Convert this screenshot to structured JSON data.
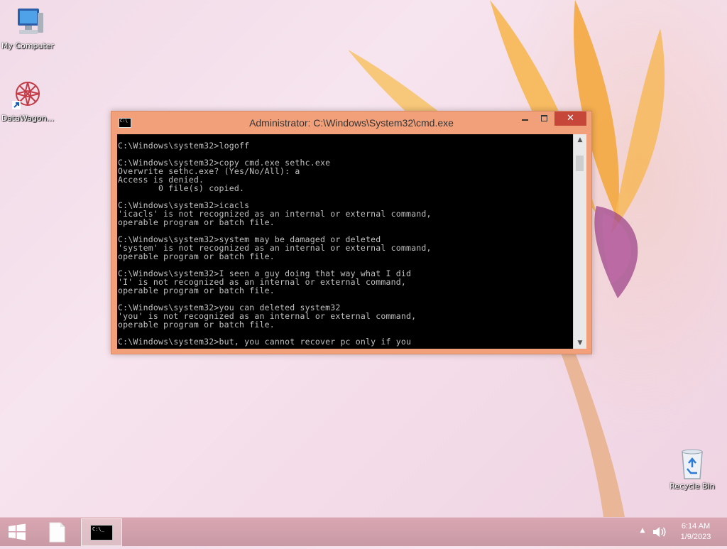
{
  "desktop": {
    "icons": [
      {
        "label": "My Computer",
        "icon": "my-computer-icon"
      },
      {
        "label": "DataWagon...",
        "icon": "datawagon-shortcut-icon"
      },
      {
        "label": "Recycle Bin",
        "icon": "recycle-bin-icon"
      }
    ]
  },
  "window": {
    "title": "Administrator: C:\\Windows\\System32\\cmd.exe",
    "icon_text": "C:\\",
    "close_glyph": "✕",
    "console_lines": [
      "C:\\Windows\\system32>logoff",
      "",
      "C:\\Windows\\system32>copy cmd.exe sethc.exe",
      "Overwrite sethc.exe? (Yes/No/All): a",
      "Access is denied.",
      "        0 file(s) copied.",
      "",
      "C:\\Windows\\system32>icacls",
      "'icacls' is not recognized as an internal or external command,",
      "operable program or batch file.",
      "",
      "C:\\Windows\\system32>system may be damaged or deleted",
      "'system' is not recognized as an internal or external command,",
      "operable program or batch file.",
      "",
      "C:\\Windows\\system32>I seen a guy doing that way what I did",
      "'I' is not recognized as an internal or external command,",
      "operable program or batch file.",
      "",
      "C:\\Windows\\system32>you can deleted system32",
      "'you' is not recognized as an internal or external command,",
      "operable program or batch file.",
      "",
      "C:\\Windows\\system32>but, you cannot recover pc only if you"
    ]
  },
  "taskbar": {
    "cmd_icon_text": "C:\\_",
    "tray_arrow": "▲",
    "time": "6:14 AM",
    "date": "1/9/2023"
  },
  "colors": {
    "window_frame": "#f2a07a",
    "close_button": "#c7463a",
    "console_bg": "#000000",
    "console_text": "#c0c0c0"
  }
}
